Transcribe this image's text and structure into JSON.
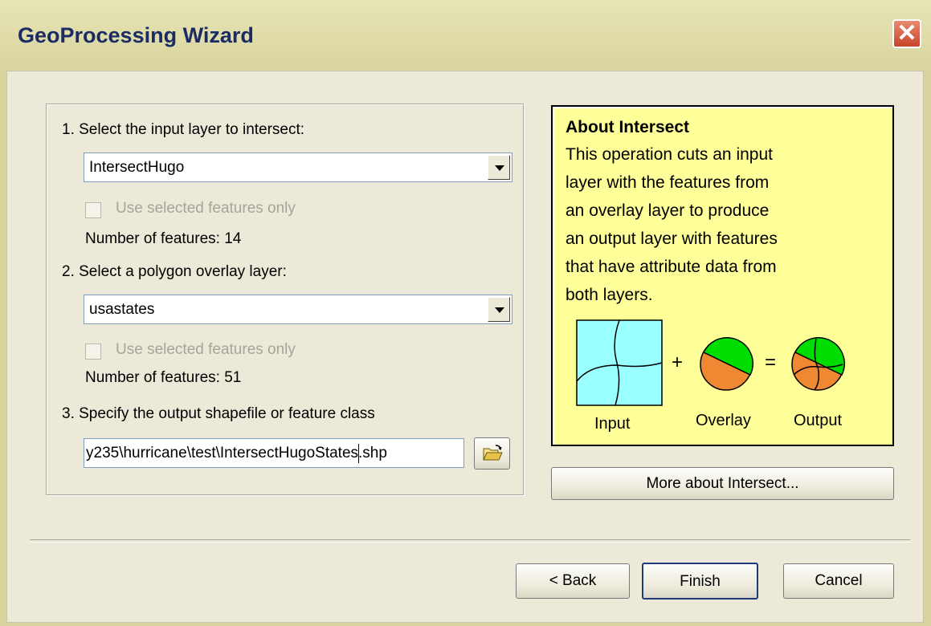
{
  "window": {
    "title": "GeoProcessing Wizard",
    "close_glyph": "✕"
  },
  "step1": {
    "label": "1. Select the input layer to intersect:",
    "value": "IntersectHugo",
    "checkbox_label": "Use selected features only",
    "checkbox_checked": false,
    "features_text": "Number of features: 14"
  },
  "step2": {
    "label": "2. Select a polygon overlay layer:",
    "value": "usastates",
    "checkbox_label": "Use selected features only",
    "checkbox_checked": false,
    "features_text": "Number of features: 51"
  },
  "step3": {
    "label": "3. Specify the output shapefile or feature class",
    "value": "y235\\hurricane\\test\\IntersectHugoStates.shp",
    "browse_icon": "open-folder-icon"
  },
  "about": {
    "title": "About Intersect",
    "lines": [
      "This operation cuts an input",
      "layer with the  features from",
      "an overlay layer to produce",
      "an output layer with features",
      "that have attribute data from",
      "both layers."
    ],
    "diagram": {
      "plus": "+",
      "equals": "=",
      "input_caption": "Input",
      "overlay_caption": "Overlay",
      "output_caption": "Output",
      "colors": {
        "input_fill": "#99ffff",
        "green": "#00dd00",
        "orange": "#ee8833"
      }
    },
    "more_button": "More about Intersect..."
  },
  "footer": {
    "back_button": "< Back",
    "finish_button": "Finish",
    "cancel_button": "Cancel"
  },
  "colors": {
    "title_text": "#1b2b63",
    "about_bg": "#ffff99",
    "dialog_bg": "#ece9d8"
  }
}
